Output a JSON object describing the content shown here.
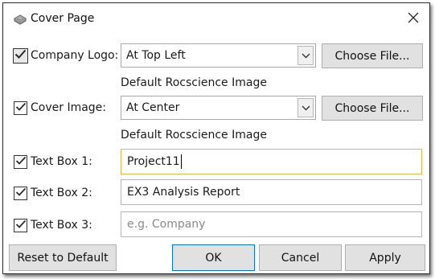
{
  "window": {
    "title": "Cover Page",
    "icon": "document-stack-icon",
    "close_icon": "close-icon"
  },
  "company_logo": {
    "checked": true,
    "label": "Company Logo:",
    "position_value": "At Top Left",
    "choose_label": "Choose File...",
    "image_caption": "Default Rocscience Image"
  },
  "cover_image": {
    "checked": true,
    "label": "Cover Image:",
    "position_value": "At Center",
    "choose_label": "Choose File...",
    "image_caption": "Default Rocscience Image"
  },
  "text_boxes": [
    {
      "checked": true,
      "label": "Text Box 1:",
      "value": "Project11",
      "placeholder": ""
    },
    {
      "checked": true,
      "label": "Text Box 2:",
      "value": "EX3 Analysis Report",
      "placeholder": ""
    },
    {
      "checked": true,
      "label": "Text Box 3:",
      "value": "",
      "placeholder": "e.g. Company"
    }
  ],
  "buttons": {
    "reset": "Reset to Default",
    "ok": "OK",
    "cancel": "Cancel",
    "apply": "Apply"
  },
  "colors": {
    "focus_border": "#e3b54f",
    "primary_border": "#0078d7",
    "button_face": "#e1e1e1"
  }
}
